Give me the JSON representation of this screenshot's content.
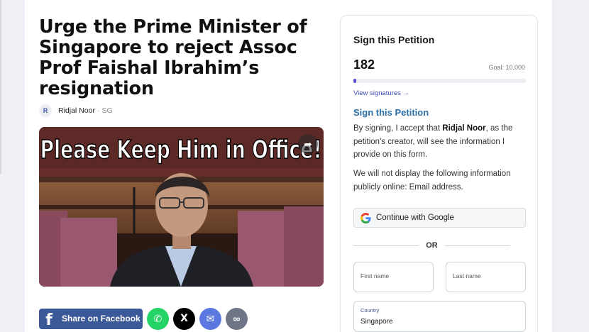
{
  "petition": {
    "title": "Urge the Prime Minister of Singapore to reject Assoc Prof Faishal Ibrahim’s resignation",
    "author_initial": "R",
    "author_name": "Ridjal Noor",
    "author_separator": "·",
    "author_location": "SG"
  },
  "video": {
    "caption": "Please Keep Him in Office!",
    "share_icon": "➦"
  },
  "share": {
    "facebook_icon": "f",
    "facebook_label": "Share on Facebook",
    "whatsapp_icon": "✆",
    "x_icon": "X",
    "email_icon": "✉",
    "link_icon": "∞"
  },
  "sidebar": {
    "title": "Sign this Petition",
    "signature_count": "182",
    "goal_label": "Goal: 10,000",
    "progress_fraction": 0.0182,
    "view_signatures": "View signatures →",
    "sign_heading": "Sign this Petition",
    "consent_prefix": "By signing, I accept that ",
    "consent_name": "Ridjal Noor",
    "consent_suffix": ", as the petition's creator, will see the information I provide on this form.",
    "privacy_text": "We will not display the following information publicly online: Email address.",
    "google_button": "Continue with Google",
    "or_label": "OR",
    "first_name_placeholder": "First name",
    "last_name_placeholder": "Last name",
    "country_label": "Country",
    "country_value": "Singapore"
  },
  "colors": {
    "accent": "#5b4fd6",
    "heading_blue": "#2a6fa8",
    "facebook": "#3b5998",
    "whatsapp": "#25d366",
    "email": "#5b78e0",
    "link": "#6e7587"
  }
}
